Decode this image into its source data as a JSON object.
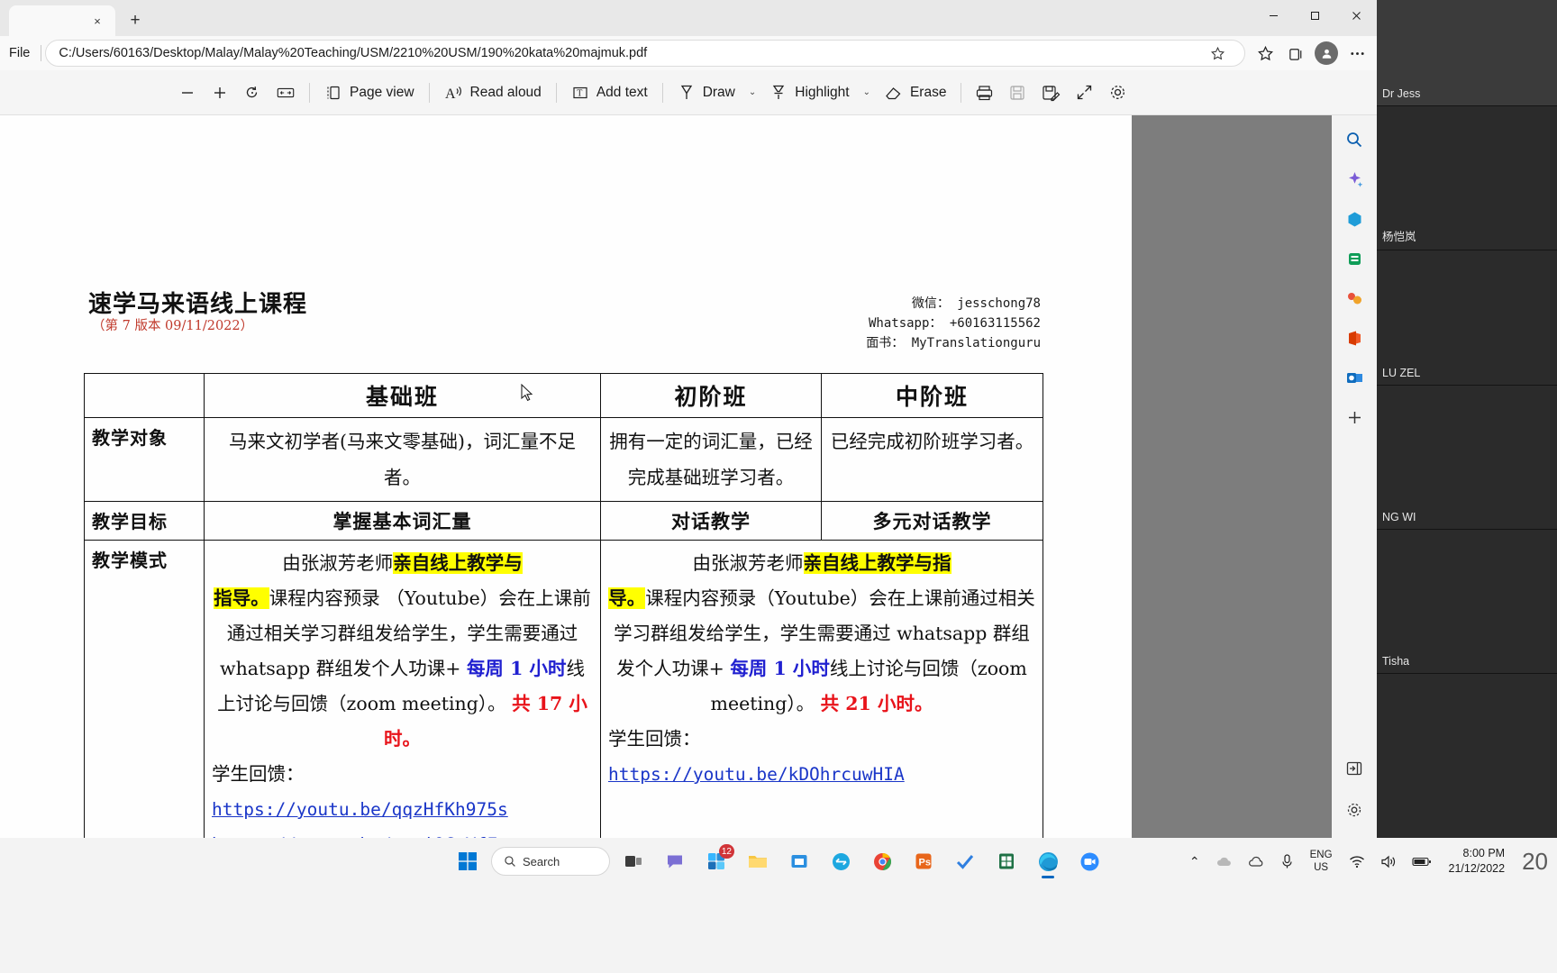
{
  "browser": {
    "tab": {
      "close_label": "×",
      "new_tab_label": "+"
    },
    "window_controls": {
      "minimize": "–",
      "maximize": "❑",
      "close": "✕"
    },
    "address": {
      "file_label": "File",
      "url": "C:/Users/60163/Desktop/Malay/Malay%20Teaching/USM/2210%20USM/190%20kata%20majmuk.pdf",
      "icons": [
        "favorite-star-icon",
        "collections-icon",
        "split-screen-icon",
        "profile-avatar-icon",
        "settings-more-icon"
      ]
    }
  },
  "pdf_toolbar": {
    "zoom_out": "−",
    "zoom_in": "+",
    "rotate": "rotate-icon",
    "fit_width": "fit-to-width-icon",
    "page_view": "Page view",
    "read_aloud": "Read aloud",
    "add_text": "Add text",
    "draw": "Draw",
    "highlight": "Highlight",
    "erase": "Erase",
    "print": "print-icon",
    "save": "save-icon",
    "save_as": "save-as-icon",
    "fullscreen": "fullscreen-icon",
    "settings": "settings-gear-icon",
    "caret": "⌄"
  },
  "document": {
    "title": "速学马来语线上课程",
    "version": "（第 7 版本  09/11/2022）",
    "contact": {
      "wechat": "微信：  jesschong78",
      "whatsapp": "Whatsapp： +60163115562",
      "facebook": "面书： MyTranslationguru"
    },
    "table": {
      "headers": [
        "",
        "基础班",
        "初阶班",
        "中阶班"
      ],
      "rows": [
        {
          "label": "教学对象",
          "basic": "马来文初学者(马来文零基础)，词汇量不足者。",
          "intermediate": "拥有一定的词汇量，已经完成基础班学习者。",
          "middle": "已经完成初阶班学习者。"
        },
        {
          "label": "教学目标",
          "basic": "掌握基本词汇量",
          "intermediate": "对话教学",
          "middle": "多元对话教学"
        },
        {
          "label": "教学模式",
          "basic_parts": {
            "p1": "由张淑芳老师",
            "hl1": "亲自线上教学与",
            "hl2": "指导。",
            "p2": "课程内容预录",
            "p3": "（Youtube）会在上课前通过相关学习群组发给学生，学生需要通过 whatsapp 群组发个人功课+",
            "blue": "每周 1 小时",
            "p4": "线上讨论与回馈（zoom meeting）。",
            "red": "共 17 小时。",
            "feedback_label": "学生回馈：",
            "links": [
              "https://youtu.be/qqzHfKh975s",
              "https://youtu.be/-ugiQCgYfFo"
            ]
          },
          "merged_parts": {
            "p1": "由张淑芳老师",
            "hl1": "亲自线上教学与指",
            "hl2": "导。",
            "p2": "课程内容预录（Youtube）会在上课前通过相关学习群组发给学生，学生需要通过 whatsapp 群组发个人功课+",
            "blue": "每周 1 小时",
            "p4": "线上讨论与回馈（zoom meeting）。",
            "red": "共 21 小时。",
            "feedback_label": "学生回馈：",
            "links": [
              "https://youtu.be/kDOhrcuwHIA"
            ]
          }
        }
      ]
    }
  },
  "edge_rail": {
    "icons": [
      "search-icon",
      "copilot-icon",
      "shopping-icon",
      "collections-icon",
      "games-icon",
      "office-icon",
      "outlook-icon",
      "add-icon"
    ],
    "bottom_icons": [
      "sidebar-toggle-icon",
      "rail-settings-icon"
    ]
  },
  "meeting_panel": {
    "participants": [
      {
        "name": "Dr Jess"
      },
      {
        "name": "杨恺岚"
      },
      {
        "name": "LU ZEL"
      },
      {
        "name": "NG WI"
      },
      {
        "name": "Tisha"
      }
    ]
  },
  "taskbar": {
    "start": "windows-start-icon",
    "search_placeholder": "Search",
    "apps": [
      {
        "name": "task-view-icon",
        "badge": ""
      },
      {
        "name": "teams-chat-icon",
        "badge": ""
      },
      {
        "name": "widgets-icon",
        "badge": "12"
      },
      {
        "name": "file-explorer-icon",
        "badge": ""
      },
      {
        "name": "store-icon",
        "badge": ""
      },
      {
        "name": "edge-dev-icon",
        "badge": ""
      },
      {
        "name": "chrome-icon",
        "badge": ""
      },
      {
        "name": "photoshop-icon",
        "badge": ""
      },
      {
        "name": "checkmark-app-icon",
        "badge": ""
      },
      {
        "name": "excel-icon",
        "badge": ""
      },
      {
        "name": "edge-icon",
        "badge": ""
      },
      {
        "name": "zoom-icon",
        "badge": ""
      }
    ],
    "tray": {
      "chevron": "⌃",
      "cloud": "cloud-icon",
      "onedrive": "onedrive-icon",
      "mic": "microphone-icon",
      "lang_top": "ENG",
      "lang_bottom": "US",
      "wifi": "wifi-icon",
      "volume": "volume-icon",
      "battery": "battery-icon",
      "time": "8:00 PM",
      "date": "21/12/2022",
      "corner_number": "20"
    }
  }
}
